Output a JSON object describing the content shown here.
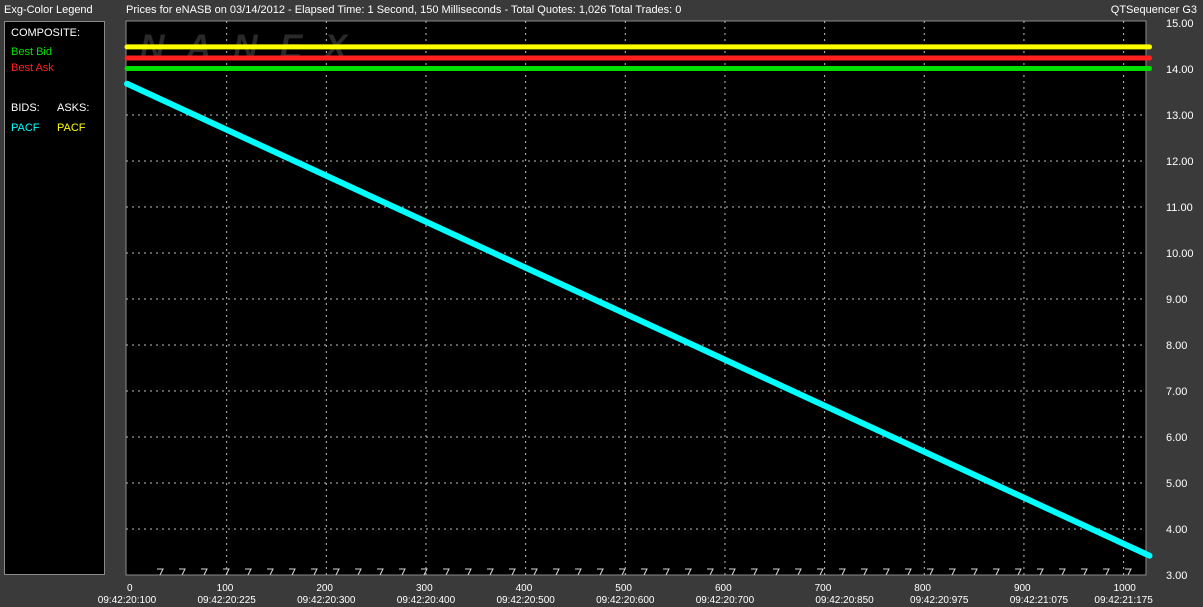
{
  "header": {
    "legend_title": "Exg-Color Legend",
    "chart_title": "Prices for  eNASB  on  03/14/2012  -  Elapsed Time: 1 Second, 150 Milliseconds  -  Total Quotes: 1,026  Total Trades: 0",
    "app_name": "QTSequencer G3"
  },
  "legend": {
    "composite_label": "COMPOSITE:",
    "best_bid": "Best Bid",
    "best_ask": "Best Ask",
    "bids_label": "BIDS:",
    "asks_label": "ASKS:",
    "bid_exchange": "PACF",
    "ask_exchange": "PACF"
  },
  "watermark": "NANEX",
  "colors": {
    "best_bid": "#00e000",
    "best_ask": "#ff2020",
    "ask_pacf": "#ffff00",
    "bid_pacf": "#00ffff",
    "grid": "#c0c0c0",
    "plot_bg": "#000000"
  },
  "chart_data": {
    "type": "line",
    "title": "Prices for  eNASB  on  03/14/2012  -  Elapsed Time: 1 Second, 150 Milliseconds  -  Total Quotes: 1,026  Total Trades: 0",
    "xlabel": "",
    "ylabel": "",
    "xlim": [
      0,
      1026
    ],
    "ylim": [
      3.0,
      15.0
    ],
    "grid": true,
    "x_ticks": [
      0,
      100,
      200,
      300,
      400,
      500,
      600,
      700,
      800,
      900,
      1000
    ],
    "x_tick_labels": [
      "0",
      "100",
      "200",
      "300",
      "400",
      "500",
      "600",
      "700",
      "800",
      "900",
      "1000"
    ],
    "time_ticks": [
      {
        "x": 0,
        "label": "09:42:20:100"
      },
      {
        "x": 100,
        "label": "09:42:20:225"
      },
      {
        "x": 200,
        "label": "09:42:20:300"
      },
      {
        "x": 300,
        "label": "09:42:20:400"
      },
      {
        "x": 400,
        "label": "09:42:20:500"
      },
      {
        "x": 500,
        "label": "09:42:20:600"
      },
      {
        "x": 600,
        "label": "09:42:20:700"
      },
      {
        "x": 720,
        "label": "09:42:20:850"
      },
      {
        "x": 815,
        "label": "09:42:20:975"
      },
      {
        "x": 915,
        "label": "09:42:21:075"
      },
      {
        "x": 1000,
        "label": "09:42:21:175"
      }
    ],
    "y_ticks": [
      3.0,
      4.0,
      5.0,
      6.0,
      7.0,
      8.0,
      9.0,
      10.0,
      11.0,
      12.0,
      13.0,
      14.0,
      15.0
    ],
    "y_tick_labels": [
      "3.00",
      "4.00",
      "5.00",
      "6.00",
      "7.00",
      "8.00",
      "9.00",
      "10.00",
      "11.00",
      "12.00",
      "13.00",
      "14.00",
      "15.00"
    ],
    "series": [
      {
        "name": "PACF",
        "side": "ask",
        "color": "#ffff00",
        "x": [
          0,
          1026
        ],
        "y": [
          14.48,
          14.48
        ]
      },
      {
        "name": "Best Ask",
        "color": "#ff2020",
        "x": [
          0,
          1026
        ],
        "y": [
          14.24,
          14.24
        ]
      },
      {
        "name": "Best Bid",
        "color": "#00e000",
        "x": [
          0,
          1026
        ],
        "y": [
          14.01,
          14.01
        ]
      },
      {
        "name": "PACF",
        "side": "bid",
        "color": "#00ffff",
        "x": [
          0,
          1026
        ],
        "y": [
          13.68,
          3.42
        ]
      }
    ]
  }
}
